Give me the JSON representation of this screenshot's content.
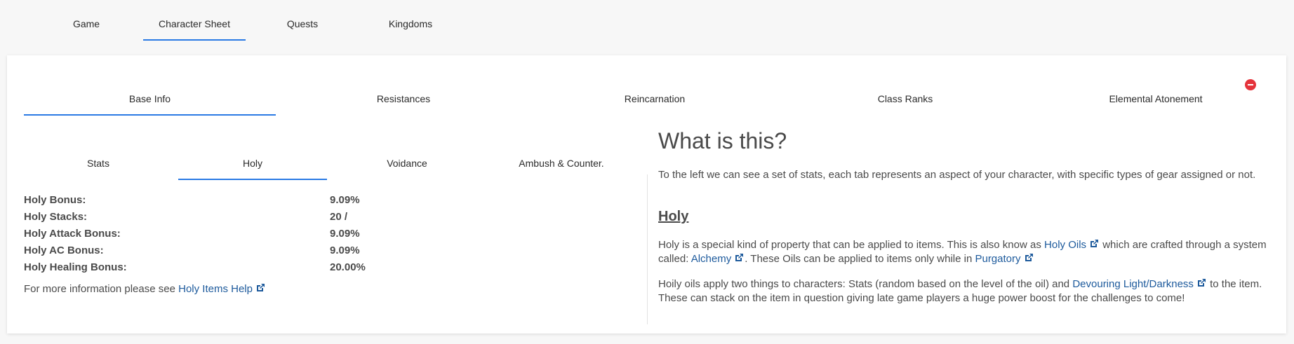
{
  "top_nav": {
    "tabs": [
      {
        "label": "Game"
      },
      {
        "label": "Character Sheet",
        "active": true
      },
      {
        "label": "Quests"
      },
      {
        "label": "Kingdoms"
      }
    ]
  },
  "section_tabs": [
    {
      "label": "Base Info",
      "active": true
    },
    {
      "label": "Resistances"
    },
    {
      "label": "Reincarnation"
    },
    {
      "label": "Class Ranks"
    },
    {
      "label": "Elemental Atonement"
    }
  ],
  "sub_tabs": [
    {
      "label": "Stats"
    },
    {
      "label": "Holy",
      "active": true
    },
    {
      "label": "Voidance"
    },
    {
      "label": "Ambush & Counter."
    }
  ],
  "holy_stats": [
    {
      "label": "Holy Bonus:",
      "value": "9.09%"
    },
    {
      "label": "Holy Stacks:",
      "value": "20 /"
    },
    {
      "label": "Holy Attack Bonus:",
      "value": "9.09%"
    },
    {
      "label": "Holy AC Bonus:",
      "value": "9.09%"
    },
    {
      "label": "Holy Healing Bonus:",
      "value": "20.00%"
    }
  ],
  "more_info": {
    "prefix": "For more information please see",
    "link": "Holy Items Help"
  },
  "help": {
    "title": "What is this?",
    "intro": "To the left we can see a set of stats, each tab represents an aspect of your character, with specific types of gear assigned or not.",
    "heading": "Holy",
    "p1_a": "Holy is a special kind of property that can be applied to items. This is also know as",
    "p1_link1": "Holy Oils",
    "p1_b": "which are crafted through a system called:",
    "p1_link2": "Alchemy",
    "p1_c": ". These Oils can be applied to items only while in",
    "p1_link3": "Purgatory",
    "p2_a": "Hoily oils apply two things to characters: Stats (random based on the level of the oil) and",
    "p2_link": "Devouring Light/Darkness",
    "p2_b": "to the item. These can stack on the item in question giving late game players a huge power boost for the challenges to come!"
  },
  "colors": {
    "accent": "#2a7ae4",
    "link": "#1d5a9c",
    "close": "#e5333b",
    "text": "#4a4a4a"
  },
  "icons": {
    "external_link": "external-link-icon",
    "close": "minus-circle-icon"
  }
}
